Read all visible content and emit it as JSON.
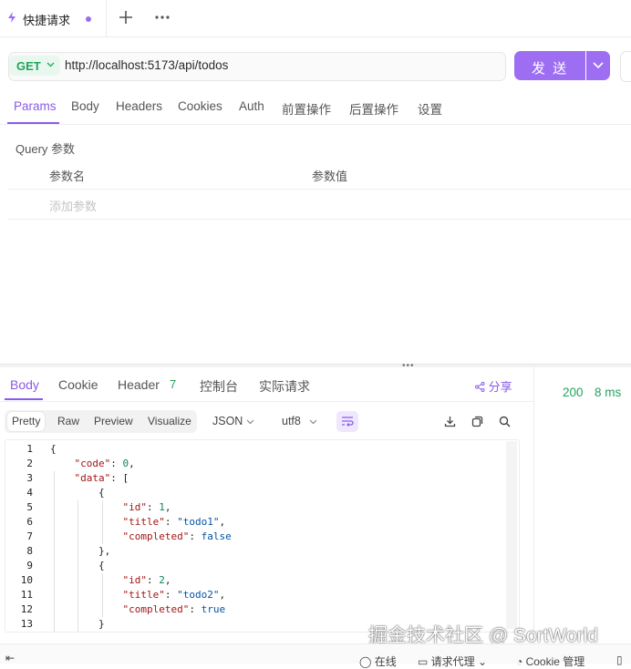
{
  "tab": {
    "title": "快捷请求"
  },
  "request": {
    "method": "GET",
    "url": "http://localhost:5173/api/todos",
    "send_label": "发 送"
  },
  "request_tabs": [
    "Params",
    "Body",
    "Headers",
    "Cookies",
    "Auth",
    "前置操作",
    "后置操作",
    "设置"
  ],
  "params": {
    "title": "Query 参数",
    "col_name": "参数名",
    "col_value": "参数值",
    "add_placeholder": "添加参数"
  },
  "response": {
    "tabs": [
      "Body",
      "Cookie",
      "Header",
      "控制台",
      "实际请求"
    ],
    "header_count": "7",
    "share": "分享",
    "status": "200",
    "time": "8 ms",
    "views": [
      "Pretty",
      "Raw",
      "Preview",
      "Visualize"
    ],
    "format": "JSON",
    "encoding": "utf8",
    "line_numbers": [
      "1",
      "2",
      "3",
      "4",
      "5",
      "6",
      "7",
      "8",
      "9",
      "10",
      "11",
      "12",
      "13"
    ]
  },
  "bottom": {
    "online": "在线",
    "proxy": "请求代理",
    "cookie": "Cookie 管理"
  },
  "watermark": "掘金技术社区 @ SortWorld",
  "colors": {
    "accent": "#9d6ef2",
    "success": "#22a45d"
  },
  "icons": [
    "flash-icon",
    "plus-icon",
    "more-icon",
    "chevron-down-icon",
    "share-icon",
    "wrap-icon",
    "download-icon",
    "copy-icon",
    "search-icon"
  ]
}
